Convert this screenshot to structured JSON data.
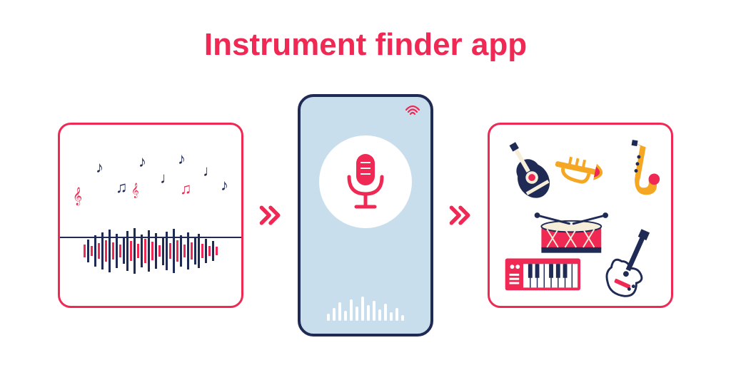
{
  "title": "Instrument finder app",
  "colors": {
    "accent": "#ef2854",
    "navy": "#1f2a55",
    "phone_bg": "#c9deed",
    "gold": "#f5a723"
  },
  "arrows": {
    "glyph": "»"
  },
  "panels": {
    "input": {
      "name": "sound-input",
      "description": "music notes and audio waveform"
    },
    "phone": {
      "name": "phone-listening",
      "description": "phone with microphone recording audio"
    },
    "output": {
      "name": "instruments-output",
      "description": "guitar, trumpet, saxophone, drum, keyboard, electric guitar"
    }
  },
  "instruments": [
    "guitar",
    "trumpet",
    "saxophone",
    "drum",
    "keyboard",
    "electric-guitar"
  ]
}
